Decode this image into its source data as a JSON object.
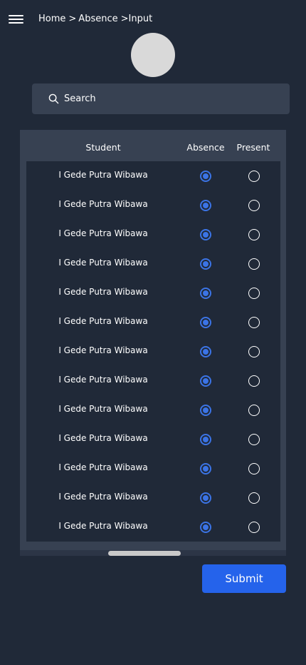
{
  "header": {
    "menu_icon": "hamburger-menu-icon",
    "breadcrumb": {
      "home": "Home",
      "sep1": ">",
      "absence": "Absence",
      "sep2": ">",
      "input": "Input"
    }
  },
  "search": {
    "icon": "search-icon",
    "placeholder": "Search"
  },
  "table": {
    "headers": {
      "student": "Student",
      "absence": "Absence",
      "present": "Present"
    },
    "rows": [
      {
        "name": "I Gede Putra Wibawa",
        "status": "absence"
      },
      {
        "name": "I Gede Putra Wibawa",
        "status": "absence"
      },
      {
        "name": "I Gede Putra Wibawa",
        "status": "absence"
      },
      {
        "name": "I Gede Putra Wibawa",
        "status": "absence"
      },
      {
        "name": "I Gede Putra Wibawa",
        "status": "absence"
      },
      {
        "name": "I Gede Putra Wibawa",
        "status": "absence"
      },
      {
        "name": "I Gede Putra Wibawa",
        "status": "absence"
      },
      {
        "name": "I Gede Putra Wibawa",
        "status": "absence"
      },
      {
        "name": "I Gede Putra Wibawa",
        "status": "absence"
      },
      {
        "name": "I Gede Putra Wibawa",
        "status": "absence"
      },
      {
        "name": "I Gede Putra Wibawa",
        "status": "absence"
      },
      {
        "name": "I Gede Putra Wibawa",
        "status": "absence"
      },
      {
        "name": "I Gede Putra Wibawa",
        "status": "absence"
      }
    ]
  },
  "actions": {
    "submit_label": "Submit"
  },
  "colors": {
    "background": "#202938",
    "panel": "#374152",
    "accent": "#2563eb",
    "radio_selected": "#3b74e6",
    "avatar": "#d9d9d9"
  }
}
